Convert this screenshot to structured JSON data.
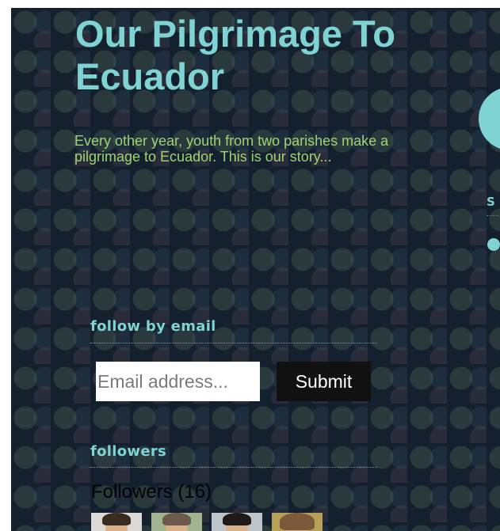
{
  "header": {
    "title": "Our Pilgrimage To Ecuador",
    "description": "Every other year, youth from two parishes make a pilgrimage to Ecuador. This is our story..."
  },
  "sidebar": {
    "label": "S"
  },
  "follow_by_email": {
    "title": "follow by email",
    "placeholder": "Email address...",
    "submit_label": "Submit"
  },
  "followers": {
    "title": "followers",
    "heading": "Followers (16)",
    "avatars": [
      "follower-1-icon",
      "follower-2-icon",
      "follower-3-icon",
      "follower-4-icon"
    ]
  },
  "colors": {
    "background": "#14202e",
    "title": "#7fd3d3",
    "description": "#9fd472",
    "button": "#111111"
  }
}
